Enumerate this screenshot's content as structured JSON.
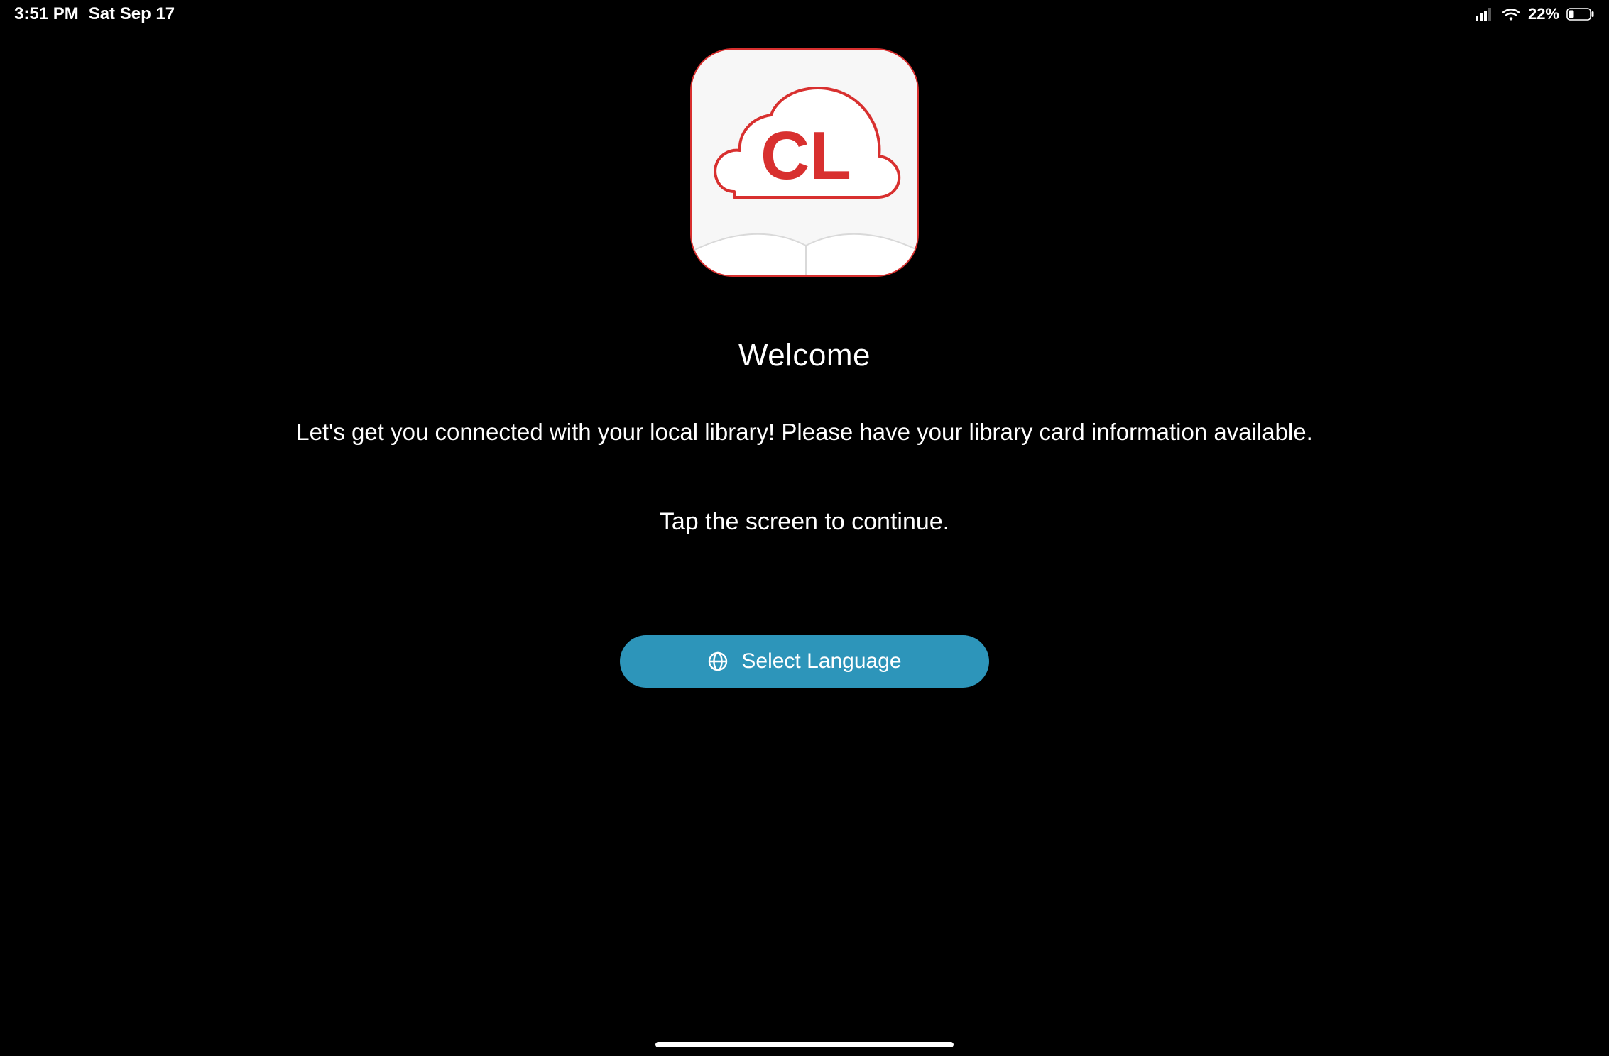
{
  "status_bar": {
    "time": "3:51 PM",
    "date": "Sat Sep 17",
    "battery_percent": "22%"
  },
  "app_logo": {
    "letters": "CL",
    "brand_color": "#d8302f"
  },
  "welcome": {
    "title": "Welcome",
    "subtitle": "Let's get you connected with your local library! Please have your library card information available.",
    "tap_hint": "Tap the screen to continue."
  },
  "language_button": {
    "label": "Select Language",
    "bg_color": "#2d95ba"
  }
}
